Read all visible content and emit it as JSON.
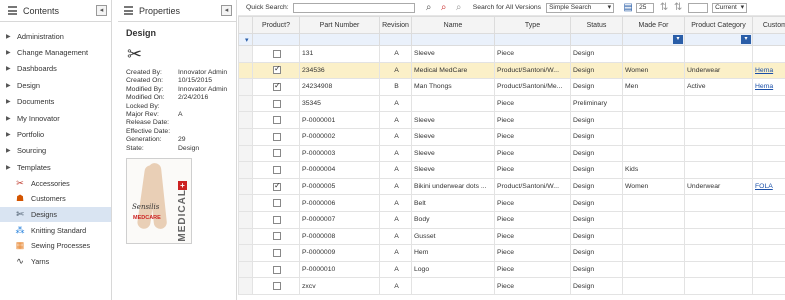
{
  "contents": {
    "title": "Contents",
    "collapse_glyph": "◂",
    "items": [
      {
        "label": "Administration"
      },
      {
        "label": "Change Management"
      },
      {
        "label": "Dashboards"
      },
      {
        "label": "Design"
      },
      {
        "label": "Documents"
      },
      {
        "label": "My Innovator"
      },
      {
        "label": "Portfolio"
      },
      {
        "label": "Sourcing"
      },
      {
        "label": "Templates"
      }
    ],
    "sub_items": [
      {
        "label": "Accessories",
        "icon": "accessories-icon",
        "glyph": "✂",
        "color": "#c0392b"
      },
      {
        "label": "Customers",
        "icon": "customers-icon",
        "glyph": "☗",
        "color": "#d35400"
      },
      {
        "label": "Designs",
        "icon": "designs-icon",
        "glyph": "✄",
        "color": "#2c3e50"
      },
      {
        "label": "Knitting Standard",
        "icon": "knitting-icon",
        "glyph": "⁂",
        "color": "#2e86de"
      },
      {
        "label": "Sewing Processes",
        "icon": "sewing-icon",
        "glyph": "▦",
        "color": "#e67e22"
      },
      {
        "label": "Yarns",
        "icon": "yarns-icon",
        "glyph": "∿",
        "color": "#333333"
      }
    ]
  },
  "properties": {
    "title": "Properties",
    "collapse_glyph": "◂",
    "item_title": "Design",
    "icon_glyph": "✂",
    "rows": [
      {
        "k": "Created By:",
        "v": "Innovator Admin"
      },
      {
        "k": "Created On:",
        "v": "10/15/2015"
      },
      {
        "k": "Modified By:",
        "v": "Innovator Admin"
      },
      {
        "k": "Modified On:",
        "v": "2/24/2016"
      },
      {
        "k": "Locked By:",
        "v": ""
      },
      {
        "k": "Major Rev:",
        "v": "A"
      },
      {
        "k": "Release Date:",
        "v": ""
      },
      {
        "k": "Effective Date:",
        "v": ""
      },
      {
        "k": "Generation:",
        "v": "29"
      },
      {
        "k": "State:",
        "v": "Design"
      }
    ],
    "thumbnail": {
      "brand": "Sensilis",
      "product": "MEDCARE",
      "vertical": "MEDICAL",
      "cross": "+"
    }
  },
  "toolbar": {
    "quick_search_label": "Quick Search:",
    "search_all_versions": "Search for All Versions",
    "search_mode": "Simple Search",
    "page_size": "25",
    "version_mode": "Current"
  },
  "grid": {
    "columns": [
      "Product?",
      "Part Number",
      "Revision",
      "Name",
      "Type",
      "Status",
      "Made For",
      "Product Category",
      "Customer"
    ],
    "rows": [
      {
        "checked": false,
        "part": "131",
        "rev": "A",
        "name": "Sleeve",
        "type": "Piece",
        "status": "Design",
        "made_for": "",
        "category": "",
        "customer": "",
        "selected": false
      },
      {
        "checked": true,
        "part": "234536",
        "rev": "A",
        "name": "Medical MedCare",
        "type": "Product/Santoni/W...",
        "status": "Design",
        "made_for": "Women",
        "category": "Underwear",
        "customer": "Hema",
        "selected": true
      },
      {
        "checked": true,
        "part": "24234908",
        "rev": "B",
        "name": "Man Thongs",
        "type": "Product/Santoni/Me...",
        "status": "Design",
        "made_for": "Men",
        "category": "Active",
        "customer": "Hema",
        "selected": false
      },
      {
        "checked": false,
        "part": "35345",
        "rev": "A",
        "name": "",
        "type": "Piece",
        "status": "Preliminary",
        "made_for": "",
        "category": "",
        "customer": "",
        "selected": false
      },
      {
        "checked": false,
        "part": "P-0000001",
        "rev": "A",
        "name": "Sleeve",
        "type": "Piece",
        "status": "Design",
        "made_for": "",
        "category": "",
        "customer": "",
        "selected": false
      },
      {
        "checked": false,
        "part": "P-0000002",
        "rev": "A",
        "name": "Sleeve",
        "type": "Piece",
        "status": "Design",
        "made_for": "",
        "category": "",
        "customer": "",
        "selected": false
      },
      {
        "checked": false,
        "part": "P-0000003",
        "rev": "A",
        "name": "Sleeve",
        "type": "Piece",
        "status": "Design",
        "made_for": "",
        "category": "",
        "customer": "",
        "selected": false
      },
      {
        "checked": false,
        "part": "P-0000004",
        "rev": "A",
        "name": "Sleeve",
        "type": "Piece",
        "status": "Design",
        "made_for": "Kids",
        "category": "",
        "customer": "",
        "selected": false
      },
      {
        "checked": true,
        "part": "P-0000005",
        "rev": "A",
        "name": "Bikini underwear dots ...",
        "type": "Product/Santoni/W...",
        "status": "Design",
        "made_for": "Women",
        "category": "Underwear",
        "customer": "FOLA",
        "selected": false
      },
      {
        "checked": false,
        "part": "P-0000006",
        "rev": "A",
        "name": "Belt",
        "type": "Piece",
        "status": "Design",
        "made_for": "",
        "category": "",
        "customer": "",
        "selected": false
      },
      {
        "checked": false,
        "part": "P-0000007",
        "rev": "A",
        "name": "Body",
        "type": "Piece",
        "status": "Design",
        "made_for": "",
        "category": "",
        "customer": "",
        "selected": false
      },
      {
        "checked": false,
        "part": "P-0000008",
        "rev": "A",
        "name": "Gusset",
        "type": "Piece",
        "status": "Design",
        "made_for": "",
        "category": "",
        "customer": "",
        "selected": false
      },
      {
        "checked": false,
        "part": "P-0000009",
        "rev": "A",
        "name": "Hem",
        "type": "Piece",
        "status": "Design",
        "made_for": "",
        "category": "",
        "customer": "",
        "selected": false
      },
      {
        "checked": false,
        "part": "P-0000010",
        "rev": "A",
        "name": "Logo",
        "type": "Piece",
        "status": "Design",
        "made_for": "",
        "category": "",
        "customer": "",
        "selected": false
      },
      {
        "checked": false,
        "part": "zxcv",
        "rev": "A",
        "name": "",
        "type": "Piece",
        "status": "Design",
        "made_for": "",
        "category": "",
        "customer": "",
        "selected": false
      }
    ]
  }
}
